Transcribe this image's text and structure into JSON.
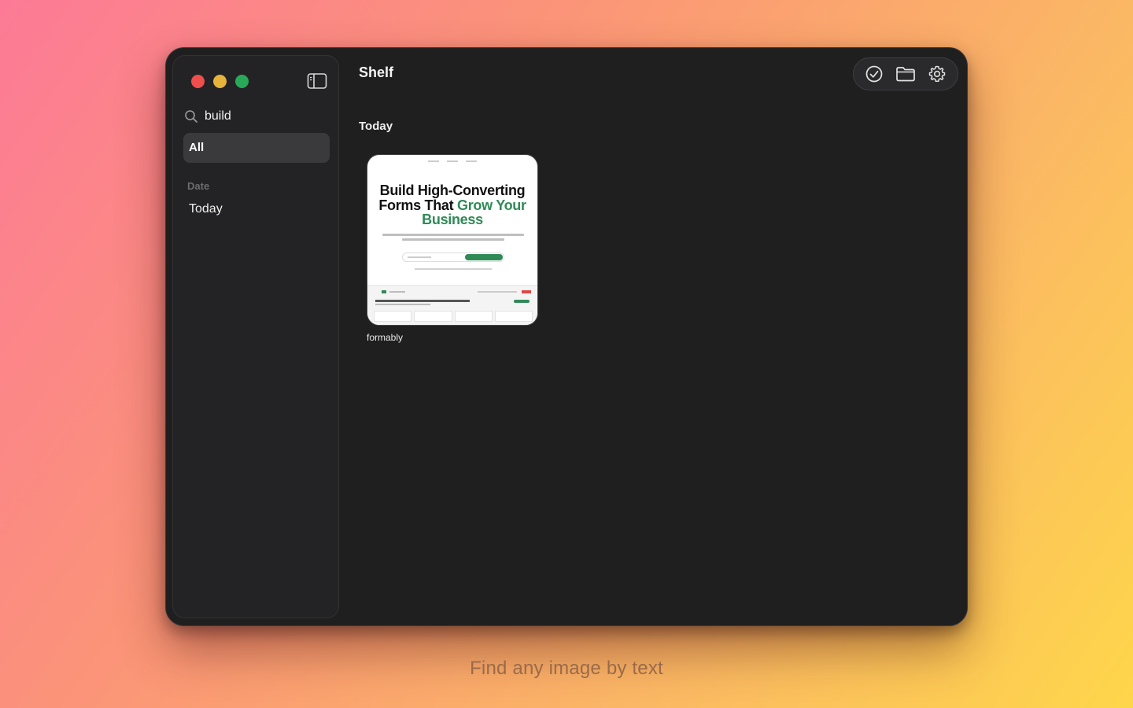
{
  "window": {
    "app_title": "Shelf"
  },
  "sidebar": {
    "search": {
      "value": "build",
      "icon": "search-icon"
    },
    "all_label": "All",
    "section_label": "Date",
    "today_label": "Today"
  },
  "toolbar": {
    "icons": [
      "checkmark-circle-icon",
      "folder-icon",
      "gear-icon"
    ]
  },
  "content": {
    "group_title": "Today",
    "items": [
      {
        "label": "formably",
        "thumbnail": {
          "headline_line1": "Build High-Converting",
          "headline_line2_dark": "Forms That ",
          "headline_line2_green": "Grow Your",
          "headline_line3_green": "Business"
        }
      }
    ]
  },
  "caption": "Find any image by text",
  "colors": {
    "window_bg": "#1f1f20",
    "sidebar_bg": "#232325",
    "selected_bg": "#3a3a3c",
    "accent_green": "#2f8a56",
    "traffic_red": "#ee4e4c",
    "traffic_yellow": "#e6b33c",
    "traffic_green": "#29a857"
  }
}
